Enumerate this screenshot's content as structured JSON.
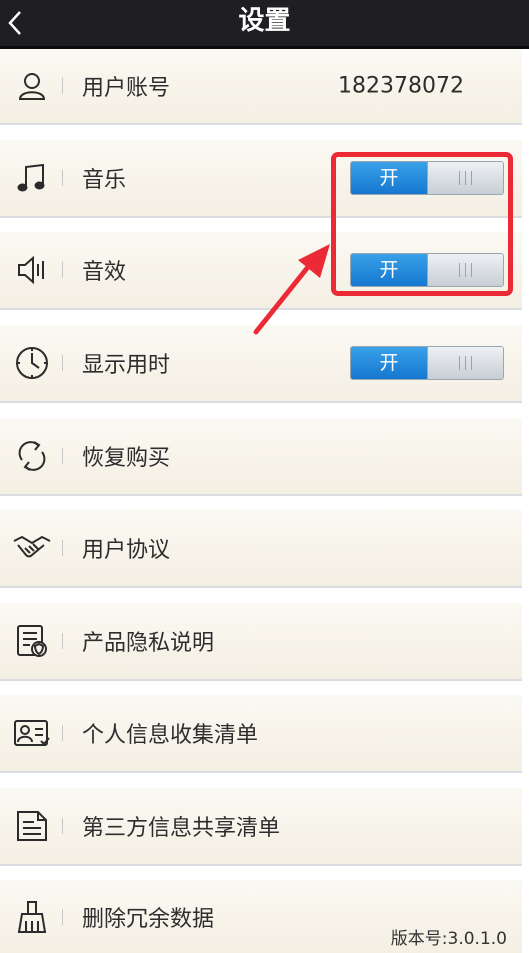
{
  "header": {
    "title": "设置",
    "back_icon": "chevron-left-icon"
  },
  "rows": [
    {
      "icon": "user-icon",
      "label": "用户账号",
      "value": "182378072"
    },
    {
      "icon": "music-note-icon",
      "label": "音乐",
      "toggle": "开"
    },
    {
      "icon": "speaker-icon",
      "label": "音效",
      "toggle": "开"
    },
    {
      "icon": "clock-icon",
      "label": "显示用时",
      "toggle": "开"
    },
    {
      "icon": "refresh-icon",
      "label": "恢复购买"
    },
    {
      "icon": "handshake-icon",
      "label": "用户协议"
    },
    {
      "icon": "privacy-document-icon",
      "label": "产品隐私说明"
    },
    {
      "icon": "id-card-icon",
      "label": "个人信息收集清单"
    },
    {
      "icon": "document-icon",
      "label": "第三方信息共享清单"
    },
    {
      "icon": "broom-icon",
      "label": "删除冗余数据"
    }
  ],
  "version": "版本号:3.0.1.0",
  "colors": {
    "toggle_on": "#1e88d8",
    "highlight": "#ec2a35",
    "header": "#1f1f23"
  }
}
